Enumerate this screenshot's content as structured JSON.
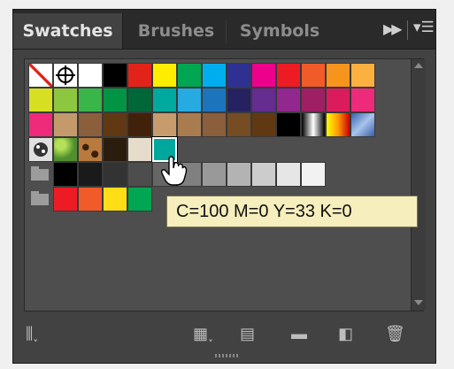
{
  "panel": {
    "tabs": [
      {
        "label": "Swatches",
        "active": true
      },
      {
        "label": "Brushes",
        "active": false
      },
      {
        "label": "Symbols",
        "active": false
      }
    ],
    "collapse_icon": "double-chevron-right-icon",
    "menu_icon": "panel-menu-icon"
  },
  "swatches": {
    "rows": [
      [
        "none",
        "registration",
        "#ffffff",
        "#000000",
        "#e2231a",
        "#ffed00",
        "#00a651",
        "#00aeef",
        "#2e3192",
        "#ec008c",
        "#ed1c24",
        "#f15a29",
        "#f7941d",
        "#fbb040"
      ],
      [
        "#d7df23",
        "#8dc63f",
        "#39b54a",
        "#009444",
        "#006838",
        "#00a99d",
        "#27aae1",
        "#1c75bc",
        "#262262",
        "#662d91",
        "#92278f",
        "#9e1f63",
        "#da1c5c",
        "#ee2a7b"
      ],
      [
        "#ee2a7b",
        "#c49a6c",
        "#8b5e3c",
        "#603913",
        "#42210b",
        "#c69c6d",
        "#a97c50",
        "#8b5e3c",
        "#754c24",
        "#603913",
        "#000000",
        "gradient-metal",
        "gradient-orange",
        "gradient-blue"
      ],
      [
        "pattern-dots",
        "pattern-green",
        "pattern-leopard",
        "#2b1d0e",
        "#e6dccb",
        "#00a79d"
      ],
      [
        "group",
        "#000000",
        "#1a1a1a",
        "#333333",
        "#4d4d4d",
        "#666666",
        "#808080",
        "#999999",
        "#b3b3b3",
        "#cccccc",
        "#e6e6e6",
        "#f2f2f2"
      ],
      [
        "group",
        "#ed1c24",
        "#f15a29",
        "#ffde17",
        "#00a651"
      ]
    ],
    "selected": "#00a79d"
  },
  "tooltip": {
    "text": "C=100 M=0 Y=33 K=0"
  },
  "bottom_icons": [
    "swatch-libraries-menu-icon",
    "show-swatch-kinds-menu-icon",
    "swatch-options-icon",
    "new-color-group-icon",
    "new-swatch-icon",
    "delete-swatch-icon"
  ]
}
